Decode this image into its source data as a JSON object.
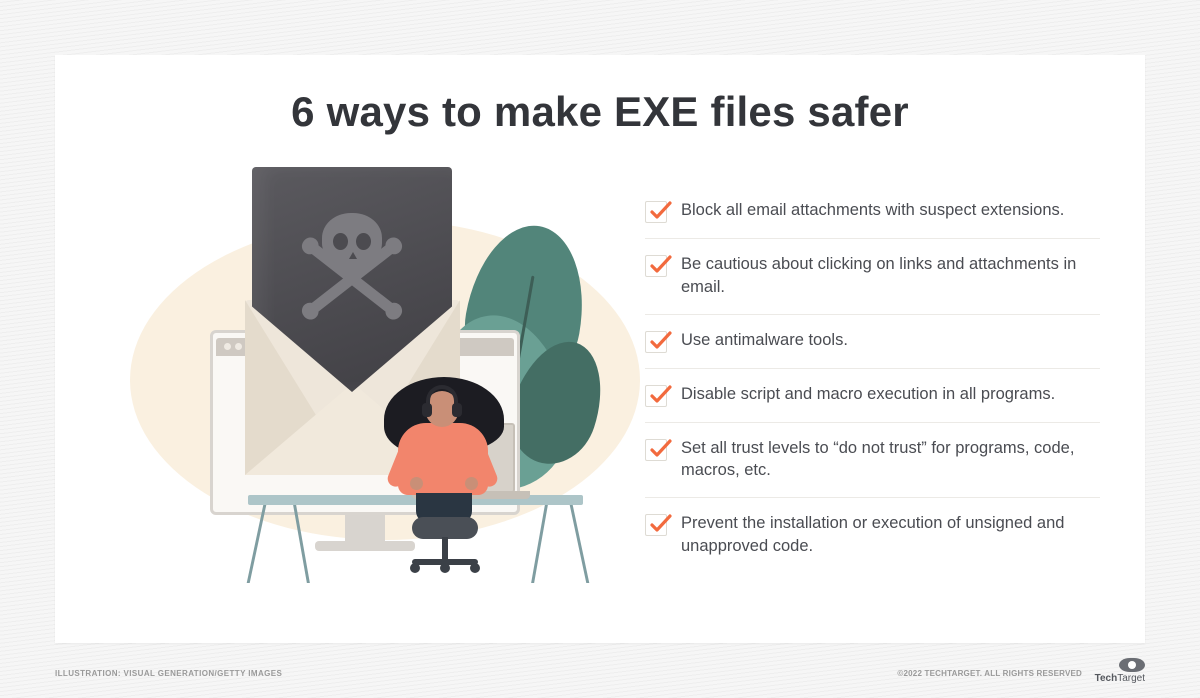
{
  "title": "6 ways to make EXE files safer",
  "items": [
    "Block all email attachments with suspect extensions.",
    "Be cautious about clicking on links and attachments in email.",
    "Use antimalware tools.",
    "Disable script and macro execution in all programs.",
    "Set all trust levels to “do not trust” for programs, code, macros, etc.",
    "Prevent the installation or execution of unsigned and unapproved code."
  ],
  "credit": "ILLUSTRATION: VISUAL GENERATION/GETTY IMAGES",
  "copyright": "©2022 TECHTARGET. ALL RIGHTS RESERVED",
  "brand_bold": "Tech",
  "brand_thin": "Target"
}
